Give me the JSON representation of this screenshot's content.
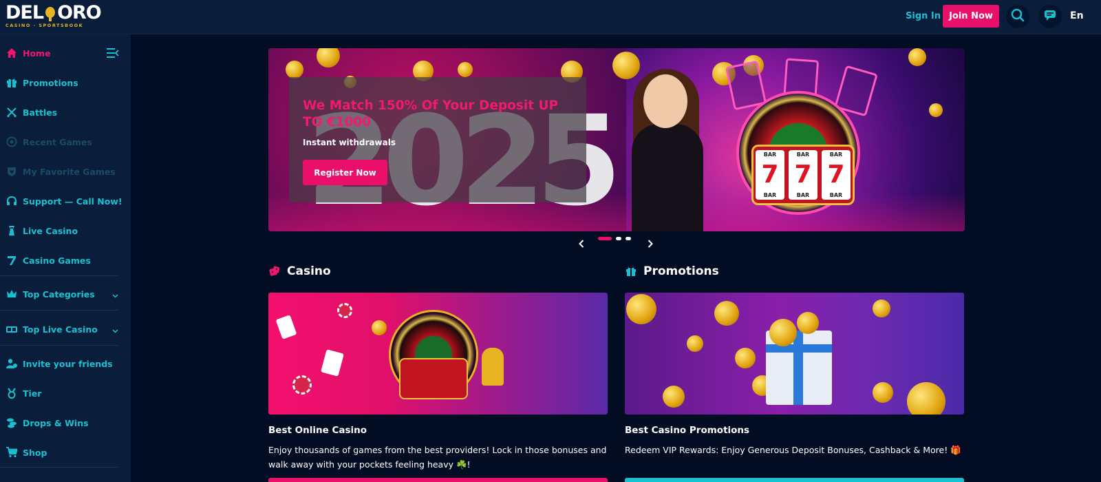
{
  "header": {
    "logo_main": "DEL ORO",
    "logo_sub": "CASINO · SPORTSBOOK",
    "signin_label": "Sign In",
    "join_label": "Join Now",
    "lang_label": "En"
  },
  "sidebar": {
    "items": [
      {
        "label": "Home",
        "icon": "home-icon"
      },
      {
        "label": "Promotions",
        "icon": "gift-icon"
      },
      {
        "label": "Battles",
        "icon": "swords-icon"
      },
      {
        "label": "Recent Games",
        "icon": "recent-icon"
      },
      {
        "label": "My Favorite Games",
        "icon": "heart-shield-icon"
      },
      {
        "label": "Support — Call Now!",
        "icon": "headset-icon"
      },
      {
        "label": "Live Casino",
        "icon": "live-casino-icon"
      },
      {
        "label": "Casino Games",
        "icon": "seven-icon"
      },
      {
        "label": "Top Categories",
        "icon": "crown-icon"
      },
      {
        "label": "Top Live Casino",
        "icon": "cards-icon"
      },
      {
        "label": "Invite your friends",
        "icon": "invite-icon"
      },
      {
        "label": "Tier",
        "icon": "medal-icon"
      },
      {
        "label": "Drops & Wins",
        "icon": "coins-icon"
      },
      {
        "label": "Shop",
        "icon": "cart-icon"
      }
    ]
  },
  "banner": {
    "title": "We Match 150% Of Your Deposit UP TO €1000",
    "subtitle": "Instant withdrawals",
    "cta_label": "Register Now",
    "year": "2025",
    "slot_top": "BAR",
    "slot_bottom": "BAR",
    "slot_symbol": "7",
    "active_slide": 1,
    "slide_count": 3
  },
  "casino": {
    "heading": "Casino",
    "title": "Best Online Casino",
    "desc": "Enjoy thousands of games from the best providers! Lock in those bonuses and walk away with your pockets feeling heavy ☘️!"
  },
  "promotions": {
    "heading": "Promotions",
    "title": "Best Casino Promotions",
    "desc": "Redeem VIP Rewards: Enjoy Generous Deposit Bonuses, Cashback & More! 🎁"
  },
  "colors": {
    "accent_pink": "#ea0f6b",
    "accent_cyan": "#1ac0d0",
    "bg": "#020d24",
    "panel": "#0a1e3c"
  }
}
